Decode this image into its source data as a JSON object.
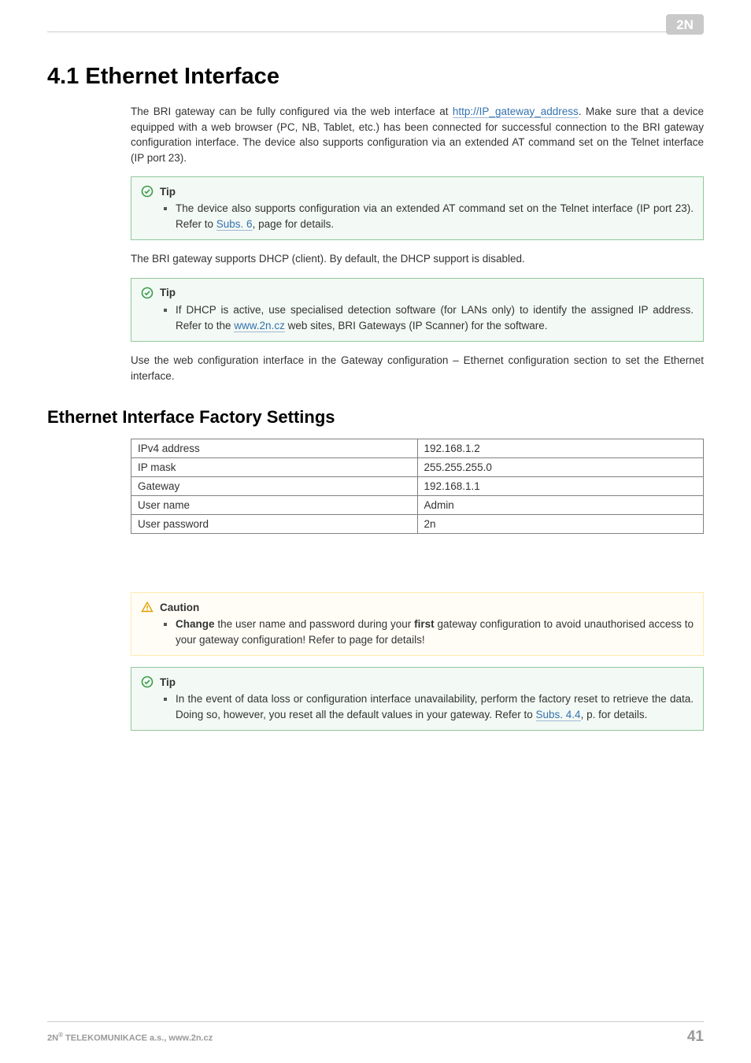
{
  "brand": {
    "logo_alt": "2N"
  },
  "heading": "4.1 Ethernet Interface",
  "intro": {
    "p1_prefix": "The BRI gateway can be fully configured via the web interface at ",
    "p1_link_text": "http://IP_gateway_address",
    "p1_suffix": ". Make sure that a device equipped with a web browser (PC, NB, Tablet, etc.) has been connected for successful connection to the BRI gateway configuration interface. The device also supports configuration via an extended AT command set on the Telnet interface (IP port 23)."
  },
  "tip_label": "Tip",
  "caution_label": "Caution",
  "tip1": {
    "prefix": "The device also supports configuration via an extended AT command set on the Telnet interface (IP port 23). Refer to ",
    "link": "Subs. 6",
    "suffix": ", page for details."
  },
  "dhcp_line": "The BRI gateway supports DHCP (client). By default, the DHCP support is disabled.",
  "tip2": {
    "prefix": "If DHCP is active, use specialised detection software (for LANs only) to identify the assigned IP address. Refer to the ",
    "link": "www.2n.cz",
    "suffix": " web sites, BRI Gateways (IP Scanner) for the software."
  },
  "post_tip2_p": "Use the web configuration interface in the Gateway configuration – Ethernet configuration section to set the Ethernet interface.",
  "subheading": "Ethernet Interface Factory Settings",
  "table": {
    "rows": [
      {
        "k": "IPv4 address",
        "v": "192.168.1.2"
      },
      {
        "k": "IP mask",
        "v": "255.255.255.0"
      },
      {
        "k": "Gateway",
        "v": "192.168.1.1"
      },
      {
        "k": "User name",
        "v": "Admin"
      },
      {
        "k": "User password",
        "v": "2n"
      }
    ]
  },
  "caution1": {
    "strong1": "Change",
    "mid": " the user name and password during your ",
    "strong2": "first",
    "suffix": " gateway configuration to avoid unauthorised access to your gateway configuration! Refer to page for details!"
  },
  "tip3": {
    "prefix": "In the event of data loss or configuration interface unavailability, perform the factory reset to retrieve the data. Doing so, however, you reset all the default values in your gateway. Refer to ",
    "link": "Subs. 4.4",
    "suffix": ", p. for details."
  },
  "footer": {
    "company_prefix": "2N",
    "reg": "®",
    "company_suffix": " TELEKOMUNIKACE a.s., www.2n.cz",
    "page_no": "41"
  }
}
